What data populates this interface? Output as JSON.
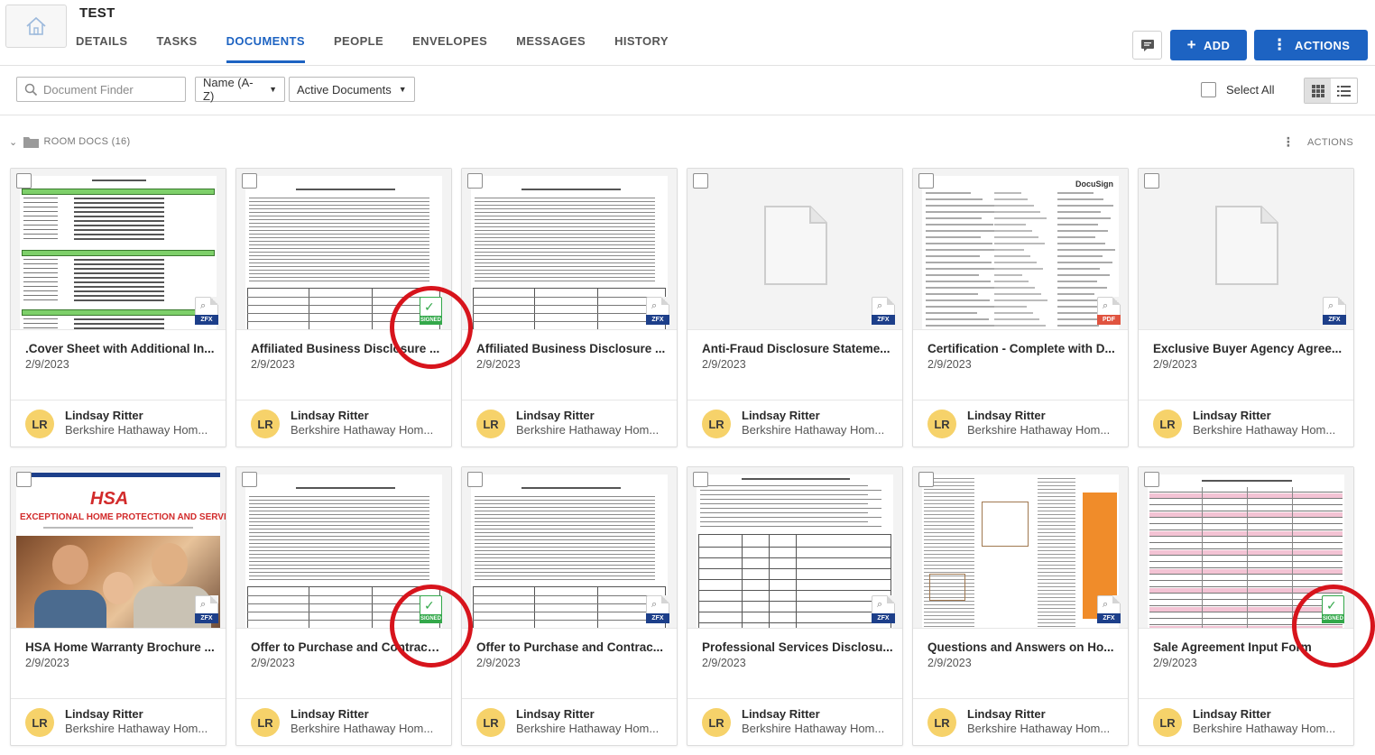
{
  "room": {
    "title": "TEST"
  },
  "tabs": [
    {
      "label": "DETAILS"
    },
    {
      "label": "TASKS"
    },
    {
      "label": "DOCUMENTS"
    },
    {
      "label": "PEOPLE"
    },
    {
      "label": "ENVELOPES"
    },
    {
      "label": "MESSAGES"
    },
    {
      "label": "HISTORY"
    }
  ],
  "header_buttons": {
    "add_label": "ADD",
    "actions_label": "ACTIONS"
  },
  "toolbar": {
    "search_placeholder": "Document Finder",
    "sort_value": "Name (A-Z)",
    "filter_value": "Active Documents",
    "select_all_label": "Select All"
  },
  "folder": {
    "label": "ROOM DOCS (16)",
    "actions_label": "ACTIONS"
  },
  "accent_color": "#1d63c2",
  "signed_color": "#33a84a",
  "annotation_color": "#d7141c",
  "documents": [
    {
      "title": ".Cover Sheet with Additional In...",
      "date": "2/9/2023",
      "agent_initials": "LR",
      "agent_name": "Lindsay Ritter",
      "agent_company": "Berkshire Hathaway Hom...",
      "file_type": "ZFX",
      "signed": false,
      "signed_label": "",
      "thumb": "cover"
    },
    {
      "title": "Affiliated Business Disclosure ...",
      "date": "2/9/2023",
      "agent_initials": "LR",
      "agent_name": "Lindsay Ritter",
      "agent_company": "Berkshire Hathaway Hom...",
      "file_type": "",
      "signed": true,
      "signed_label": "SIGNED",
      "thumb": "text"
    },
    {
      "title": "Affiliated Business Disclosure ...",
      "date": "2/9/2023",
      "agent_initials": "LR",
      "agent_name": "Lindsay Ritter",
      "agent_company": "Berkshire Hathaway Hom...",
      "file_type": "ZFX",
      "signed": false,
      "signed_label": "",
      "thumb": "text"
    },
    {
      "title": "Anti-Fraud Disclosure Stateme...",
      "date": "2/9/2023",
      "agent_initials": "LR",
      "agent_name": "Lindsay Ritter",
      "agent_company": "Berkshire Hathaway Hom...",
      "file_type": "ZFX",
      "signed": false,
      "signed_label": "",
      "thumb": "blank"
    },
    {
      "title": "Certification - Complete with D...",
      "date": "2/9/2023",
      "agent_initials": "LR",
      "agent_name": "Lindsay Ritter",
      "agent_company": "Berkshire Hathaway Hom...",
      "file_type": "PDF",
      "signed": false,
      "signed_label": "",
      "thumb": "docusign",
      "thumb_brand": "DocuSign"
    },
    {
      "title": "Exclusive Buyer Agency Agree...",
      "date": "2/9/2023",
      "agent_initials": "LR",
      "agent_name": "Lindsay Ritter",
      "agent_company": "Berkshire Hathaway Hom...",
      "file_type": "ZFX",
      "signed": false,
      "signed_label": "",
      "thumb": "blank"
    },
    {
      "title": "HSA Home Warranty Brochure ...",
      "date": "2/9/2023",
      "agent_initials": "LR",
      "agent_name": "Lindsay Ritter",
      "agent_company": "Berkshire Hathaway Hom...",
      "file_type": "ZFX",
      "signed": false,
      "signed_label": "",
      "thumb": "hsa",
      "thumb_brand": "HSA",
      "thumb_headline": "EXCEPTIONAL HOME PROTECTION AND SERVICE."
    },
    {
      "title": "Offer to Purchase and Contract ...",
      "date": "2/9/2023",
      "agent_initials": "LR",
      "agent_name": "Lindsay Ritter",
      "agent_company": "Berkshire Hathaway Hom...",
      "file_type": "",
      "signed": true,
      "signed_label": "SIGNED",
      "thumb": "text"
    },
    {
      "title": "Offer to Purchase and Contrac...",
      "date": "2/9/2023",
      "agent_initials": "LR",
      "agent_name": "Lindsay Ritter",
      "agent_company": "Berkshire Hathaway Hom...",
      "file_type": "ZFX",
      "signed": false,
      "signed_label": "",
      "thumb": "text"
    },
    {
      "title": "Professional Services Disclosu...",
      "date": "2/9/2023",
      "agent_initials": "LR",
      "agent_name": "Lindsay Ritter",
      "agent_company": "Berkshire Hathaway Hom...",
      "file_type": "ZFX",
      "signed": false,
      "signed_label": "",
      "thumb": "table"
    },
    {
      "title": "Questions and Answers on Ho...",
      "date": "2/9/2023",
      "agent_initials": "LR",
      "agent_name": "Lindsay Ritter",
      "agent_company": "Berkshire Hathaway Hom...",
      "file_type": "ZFX",
      "signed": false,
      "signed_label": "",
      "thumb": "qa"
    },
    {
      "title": "Sale Agreement Input Form",
      "date": "2/9/2023",
      "agent_initials": "LR",
      "agent_name": "Lindsay Ritter",
      "agent_company": "Berkshire Hathaway Hom...",
      "file_type": "",
      "signed": true,
      "signed_label": "SIGNED",
      "thumb": "form"
    }
  ]
}
